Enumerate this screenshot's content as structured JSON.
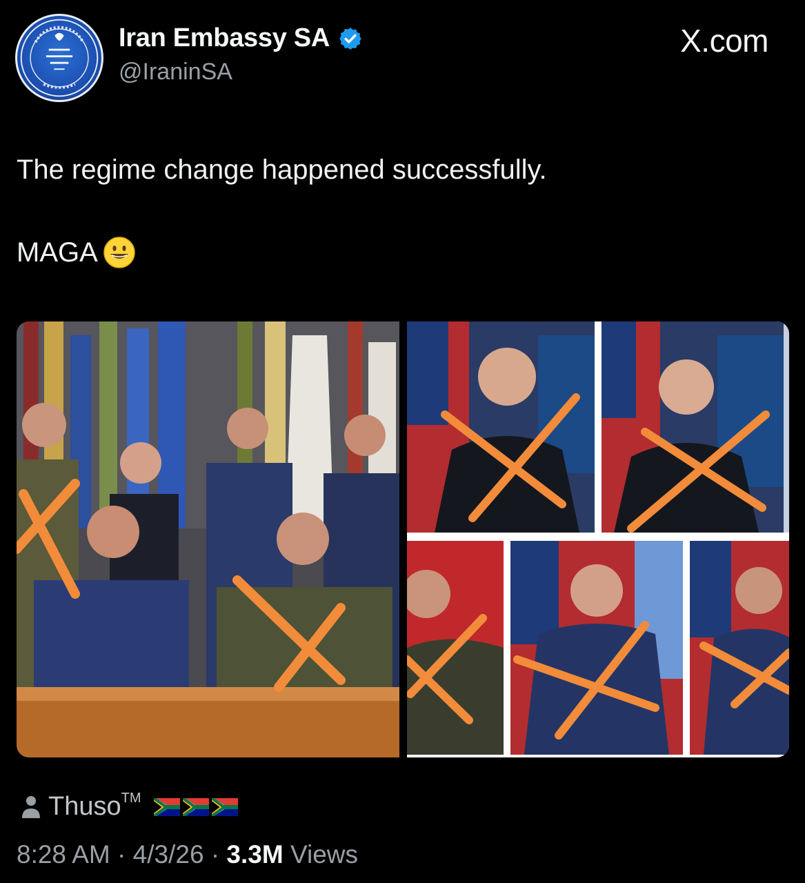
{
  "account": {
    "display_name": "Iran Embassy SA",
    "handle": "@IraninSA",
    "verified_icon": "verified-badge-icon",
    "avatar_icon": "embassy-seal-icon"
  },
  "watermark": "X.com",
  "tweet": {
    "line1": "The regime change happened successfully.",
    "line2": "MAGA",
    "emoji": "grinning-face-emoji"
  },
  "media": {
    "left_photo": "group-photo-military-officers-crossed-out",
    "right_photo": "collage-officer-portraits-crossed-out",
    "cross_color": "#f28c3a"
  },
  "community_note_user": {
    "name": "Thuso",
    "suffix": "TM",
    "flag_icons": [
      "south-africa-flag-icon",
      "south-africa-flag-icon",
      "south-africa-flag-icon"
    ]
  },
  "meta": {
    "time": "8:28 AM",
    "sep1": "·",
    "date": "4/3/26",
    "sep2": "·",
    "views_count": "3.3M",
    "views_label": "Views"
  },
  "colors": {
    "background": "#000000",
    "text_primary": "#e7e9ea",
    "text_secondary": "#9aa0a6",
    "verified_blue": "#1d9bf0"
  }
}
